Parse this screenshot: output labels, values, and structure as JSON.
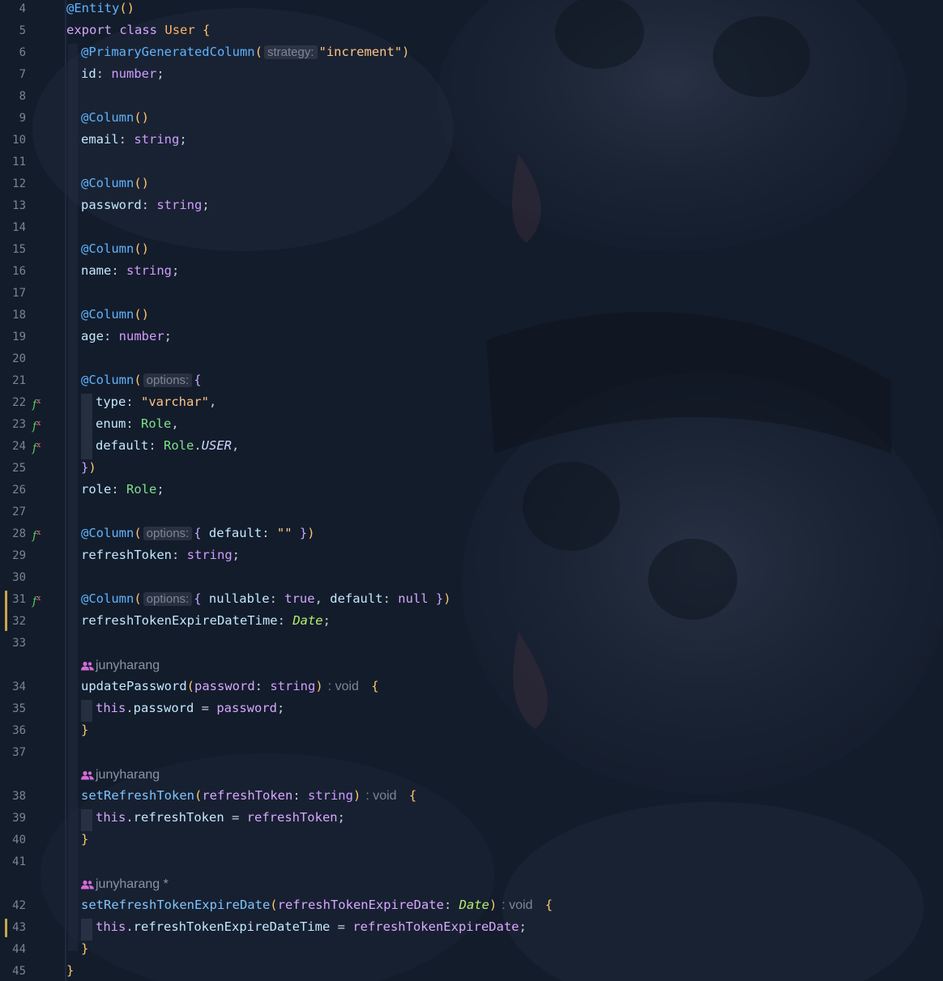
{
  "editor": {
    "colors": {
      "background": "#131c2b",
      "decorator": "#5fb4ff",
      "keyword": "#d6a4ff",
      "string": "#ffc485",
      "change_marker": "#c8a64a"
    },
    "lines": [
      {
        "n": "4"
      },
      {
        "n": "5"
      },
      {
        "n": "6"
      },
      {
        "n": "7"
      },
      {
        "n": "8"
      },
      {
        "n": "9"
      },
      {
        "n": "10"
      },
      {
        "n": "11"
      },
      {
        "n": "12"
      },
      {
        "n": "13"
      },
      {
        "n": "14"
      },
      {
        "n": "15"
      },
      {
        "n": "16"
      },
      {
        "n": "17"
      },
      {
        "n": "18"
      },
      {
        "n": "19"
      },
      {
        "n": "20"
      },
      {
        "n": "21"
      },
      {
        "n": "22"
      },
      {
        "n": "23"
      },
      {
        "n": "24"
      },
      {
        "n": "25"
      },
      {
        "n": "26"
      },
      {
        "n": "27"
      },
      {
        "n": "28"
      },
      {
        "n": "29"
      },
      {
        "n": "30"
      },
      {
        "n": "31"
      },
      {
        "n": "32"
      },
      {
        "n": "33"
      },
      {
        "n": "34"
      },
      {
        "n": "35"
      },
      {
        "n": "36"
      },
      {
        "n": "37"
      },
      {
        "n": "38"
      },
      {
        "n": "39"
      },
      {
        "n": "40"
      },
      {
        "n": "41"
      },
      {
        "n": "42"
      },
      {
        "n": "43"
      },
      {
        "n": "44"
      },
      {
        "n": "45"
      }
    ],
    "gutter_icon": "function-mapping-icon",
    "tokens": {
      "entity": "@Entity",
      "export": "export",
      "class": "class",
      "user": "User",
      "pgc": "@PrimaryGeneratedColumn",
      "strategy_hint": "strategy:",
      "increment": "\"increment\"",
      "id": "id",
      "number": "number",
      "column": "@Column",
      "email": "email",
      "string": "string",
      "password": "password",
      "name": "name",
      "age": "age",
      "options_hint": "options:",
      "type": "type",
      "varchar": "\"varchar\"",
      "enum": "enum",
      "role_type": "Role",
      "default": "default",
      "role_user": "USER",
      "role": "role",
      "empty_str": "\"\"",
      "refresh_token": "refreshToken",
      "nullable": "nullable",
      "true": "true",
      "null": "null",
      "rt_expire_field": "refreshTokenExpireDateTime",
      "date": "Date",
      "author_1": "junyharang",
      "author_2": "junyharang",
      "author_3": "junyharang *",
      "update_password": "updatePassword",
      "void_hint": ": void",
      "this": "this",
      "set_refresh_token": "setRefreshToken",
      "set_rt_expire": "setRefreshTokenExpireDate",
      "rt_expire_param": "refreshTokenExpireDate"
    }
  }
}
